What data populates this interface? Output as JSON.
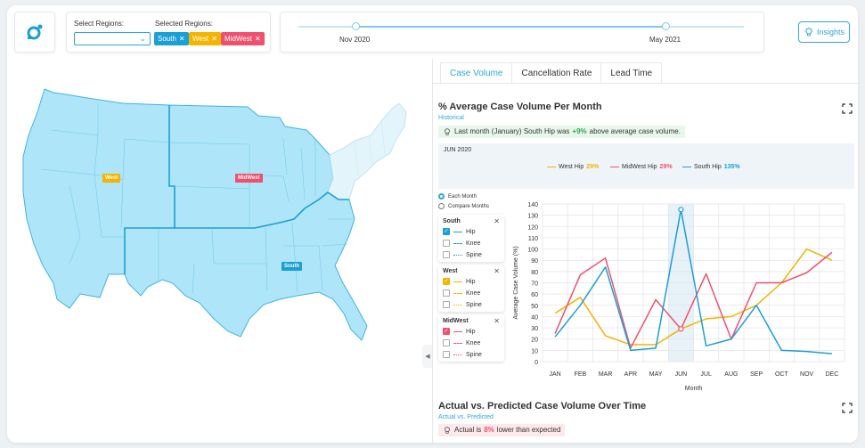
{
  "filters": {
    "select_regions_label": "Select Regions:",
    "selected_regions_label": "Selected Regions:",
    "chips": [
      {
        "label": "South",
        "color": "#1a9fd8"
      },
      {
        "label": "West",
        "color": "#f4b400"
      },
      {
        "label": "MidWest",
        "color": "#f0506e"
      }
    ]
  },
  "timeline": {
    "start": "Nov 2020",
    "end": "May 2021"
  },
  "insights_label": "Insights",
  "map": {
    "labels": [
      {
        "text": "West",
        "color": "#f4b400"
      },
      {
        "text": "MidWest",
        "color": "#f0506e"
      },
      {
        "text": "South",
        "color": "#1a9fd8"
      }
    ]
  },
  "tabs": [
    "Case Volume",
    "Cancellation Rate",
    "Lead Time"
  ],
  "section1": {
    "title": "% Average Case Volume Per Month",
    "subtitle": "Historical",
    "note_pre": "Last month (January) South Hip was ",
    "note_val": "+9%",
    "note_post": " above average case volume."
  },
  "legend": {
    "date": "JUN 2020",
    "items": [
      {
        "label": "West Hip",
        "value": "29%",
        "color": "#f4b400"
      },
      {
        "label": "MidWest Hip",
        "value": "29%",
        "color": "#f0506e"
      },
      {
        "label": "South Hip",
        "value": "135%",
        "color": "#1a9fd8"
      }
    ]
  },
  "modes": [
    "Each Month",
    "Compare Months"
  ],
  "filter_boxes": [
    {
      "title": "South",
      "color": "#1a9fd8",
      "items": [
        "Hip",
        "Knee",
        "Spine"
      ]
    },
    {
      "title": "West",
      "color": "#f4b400",
      "items": [
        "Hip",
        "Knee",
        "Spine"
      ]
    },
    {
      "title": "MidWest",
      "color": "#f0506e",
      "items": [
        "Hip",
        "Knee",
        "Spine"
      ]
    }
  ],
  "chart_data": {
    "type": "line",
    "categories": [
      "JAN",
      "FEB",
      "MAR",
      "APR",
      "MAY",
      "JUN",
      "JUL",
      "AUG",
      "SEP",
      "OCT",
      "NOV",
      "DEC"
    ],
    "xlabel": "Month",
    "ylabel": "Average Case Volume (%)",
    "ylim": [
      0,
      140
    ],
    "yticks": [
      0,
      10,
      20,
      30,
      40,
      50,
      60,
      70,
      80,
      90,
      100,
      110,
      120,
      130,
      140
    ],
    "highlight": "JUN",
    "series": [
      {
        "name": "West Hip",
        "color": "#f4b400",
        "values": [
          43,
          57,
          23,
          15,
          15,
          29,
          38,
          40,
          50,
          70,
          100,
          90
        ]
      },
      {
        "name": "MidWest Hip",
        "color": "#f0506e",
        "values": [
          25,
          77,
          92,
          12,
          55,
          29,
          78,
          20,
          70,
          70,
          79,
          97
        ]
      },
      {
        "name": "South Hip",
        "color": "#1a9fd8",
        "values": [
          22,
          50,
          84,
          10,
          12,
          135,
          14,
          20,
          50,
          10,
          9,
          7
        ]
      }
    ]
  },
  "section2": {
    "title": "Actual vs. Predicted Case Volume Over Time",
    "subtitle": "Actual vs. Predicted",
    "note_pre": "Actual is ",
    "note_val": "8%",
    "note_post": " lower than expected"
  }
}
